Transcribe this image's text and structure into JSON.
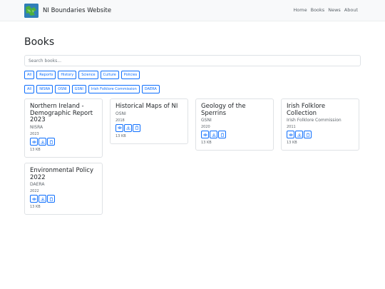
{
  "nav": {
    "brand": "NI Boundaries Website",
    "links": [
      "Home",
      "Books",
      "News",
      "About"
    ]
  },
  "page": {
    "title": "Books"
  },
  "search": {
    "placeholder": "Search books..."
  },
  "filters": {
    "categories": [
      "All",
      "Reports",
      "History",
      "Science",
      "Culture",
      "Policies"
    ],
    "organisations": [
      "All",
      "NISRA",
      "OSNI",
      "GSNI",
      "Irish Folklore Commission",
      "DAERA"
    ]
  },
  "books": [
    {
      "title": "Northern Ireland - Demographic Report 2023",
      "org": "NISRA",
      "year": "2023",
      "size": "13 KB"
    },
    {
      "title": "Historical Maps of NI",
      "org": "OSNI",
      "year": "2018",
      "size": "13 KB"
    },
    {
      "title": "Geology of the Sperrins",
      "org": "GSNI",
      "year": "2020",
      "size": "13 KB"
    },
    {
      "title": "Irish Folklore Collection",
      "org": "Irish Folklore Commission",
      "year": "2011",
      "size": "13 KB"
    },
    {
      "title": "Environmental Policy 2022",
      "org": "DAERA",
      "year": "2022",
      "size": "13 KB"
    }
  ],
  "icons": {
    "logo": "map-logo-icon",
    "view": "eye-icon",
    "download": "download-icon",
    "copy": "clipboard-icon"
  },
  "colors": {
    "accent": "#0d6efd",
    "navbar_bg": "#f8f9fa",
    "logo_blue": "#2f7fb8",
    "logo_green": "#4caf3f"
  }
}
